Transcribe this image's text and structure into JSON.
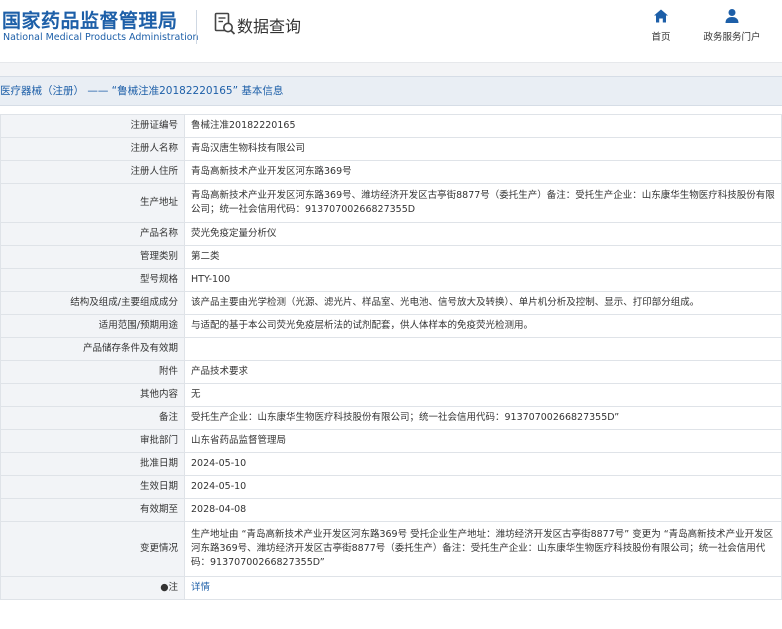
{
  "header": {
    "logo_cn": "国家药品监督管理局",
    "logo_en": "National Medical Products Administration",
    "subtitle": "数据查询",
    "nav": [
      {
        "label": "首页",
        "icon": "home-icon"
      },
      {
        "label": "政务服务门户",
        "icon": "user-icon"
      }
    ]
  },
  "breadcrumb": "医疗器械（注册） —— “鲁械注准20182220165” 基本信息",
  "colors": {
    "brand": "#1d5fa8",
    "label_bg": "#f2f4f7",
    "crumb_bg": "#e9eef4"
  },
  "rows": [
    {
      "key": "注册证编号",
      "value": "鲁械注准20182220165"
    },
    {
      "key": "注册人名称",
      "value": "青岛汉唐生物科技有限公司"
    },
    {
      "key": "注册人住所",
      "value": "青岛高新技术产业开发区河东路369号"
    },
    {
      "key": "生产地址",
      "value": "青岛高新技术产业开发区河东路369号、潍坊经济开发区古亭街8877号（委托生产）备注：受托生产企业：山东康华生物医疗科技股份有限公司；统一社会信用代码：91370700266827355D"
    },
    {
      "key": "产品名称",
      "value": "荧光免疫定量分析仪"
    },
    {
      "key": "管理类别",
      "value": "第二类"
    },
    {
      "key": "型号规格",
      "value": "HTY-100"
    },
    {
      "key": "结构及组成/主要组成成分",
      "value": "该产品主要由光学检测（光源、滤光片、样品室、光电池、信号放大及转换）、单片机分析及控制、显示、打印部分组成。"
    },
    {
      "key": "适用范围/预期用途",
      "value": "与适配的基于本公司荧光免疫层析法的试剂配套，供人体样本的免疫荧光检测用。"
    },
    {
      "key": "产品储存条件及有效期",
      "value": ""
    },
    {
      "key": "附件",
      "value": "产品技术要求"
    },
    {
      "key": "其他内容",
      "value": "无"
    },
    {
      "key": "备注",
      "value": "受托生产企业：山东康华生物医疗科技股份有限公司；统一社会信用代码：91370700266827355D”"
    },
    {
      "key": "审批部门",
      "value": "山东省药品监督管理局"
    },
    {
      "key": "批准日期",
      "value": "2024-05-10"
    },
    {
      "key": "生效日期",
      "value": "2024-05-10"
    },
    {
      "key": "有效期至",
      "value": "2028-04-08"
    },
    {
      "key": "变更情况",
      "value": "生产地址由 “青岛高新技术产业开发区河东路369号 受托企业生产地址：潍坊经济开发区古亭街8877号” 变更为 “青岛高新技术产业开发区河东路369号、潍坊经济开发区古亭街8877号（委托生产）备注：受托生产企业：山东康华生物医疗科技股份有限公司；统一社会信用代码：91370700266827355D”"
    }
  ],
  "note_row": {
    "key": "●注",
    "link": "详情"
  }
}
